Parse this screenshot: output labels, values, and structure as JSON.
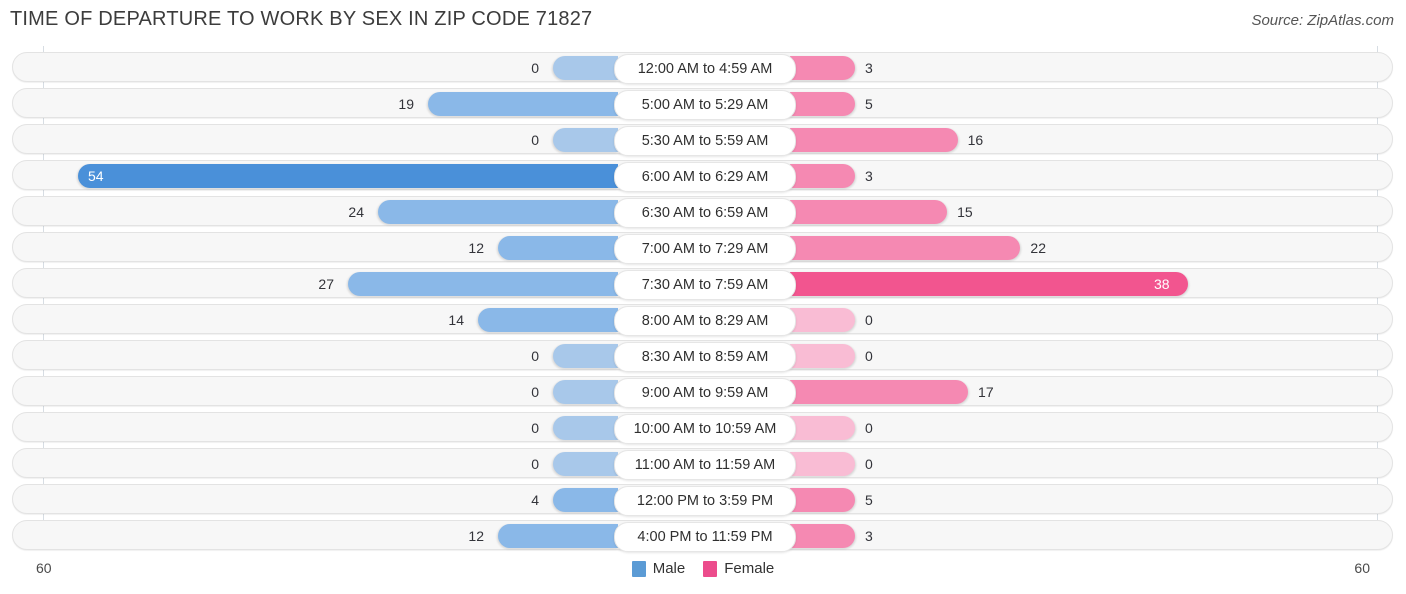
{
  "header": {
    "title": "TIME OF DEPARTURE TO WORK BY SEX IN ZIP CODE 71827",
    "source": "Source: ZipAtlas.com"
  },
  "axis": {
    "left_label": "60",
    "right_label": "60"
  },
  "legend": {
    "items": [
      {
        "label": "Male",
        "color": "#5b9bd5"
      },
      {
        "label": "Female",
        "color": "#ec4c8c"
      }
    ]
  },
  "colors": {
    "male_max": "#4a90d9",
    "male_mid": "#8ab8e8",
    "male_zero": "#a8c8ea",
    "female_max": "#f2558f",
    "female_mid": "#f589b2",
    "female_zero": "#f9bcd4",
    "track": "#f7f7f7",
    "gridline": "#d7dde3"
  },
  "chart_data": {
    "type": "bar",
    "title": "TIME OF DEPARTURE TO WORK BY SEX IN ZIP CODE 71827",
    "orientation": "horizontal-diverging",
    "xlabel": "",
    "ylabel": "",
    "xlim": [
      60,
      60
    ],
    "grid": true,
    "legend_position": "bottom-center",
    "categories": [
      "12:00 AM to 4:59 AM",
      "5:00 AM to 5:29 AM",
      "5:30 AM to 5:59 AM",
      "6:00 AM to 6:29 AM",
      "6:30 AM to 6:59 AM",
      "7:00 AM to 7:29 AM",
      "7:30 AM to 7:59 AM",
      "8:00 AM to 8:29 AM",
      "8:30 AM to 8:59 AM",
      "9:00 AM to 9:59 AM",
      "10:00 AM to 10:59 AM",
      "11:00 AM to 11:59 AM",
      "12:00 PM to 3:59 PM",
      "4:00 PM to 11:59 PM"
    ],
    "series": [
      {
        "name": "Male",
        "color": "#5b9bd5",
        "values": [
          0,
          19,
          0,
          54,
          24,
          12,
          27,
          14,
          0,
          0,
          0,
          0,
          4,
          12
        ]
      },
      {
        "name": "Female",
        "color": "#ec4c8c",
        "values": [
          3,
          5,
          16,
          3,
          15,
          22,
          38,
          0,
          0,
          17,
          0,
          0,
          5,
          3
        ]
      }
    ]
  }
}
